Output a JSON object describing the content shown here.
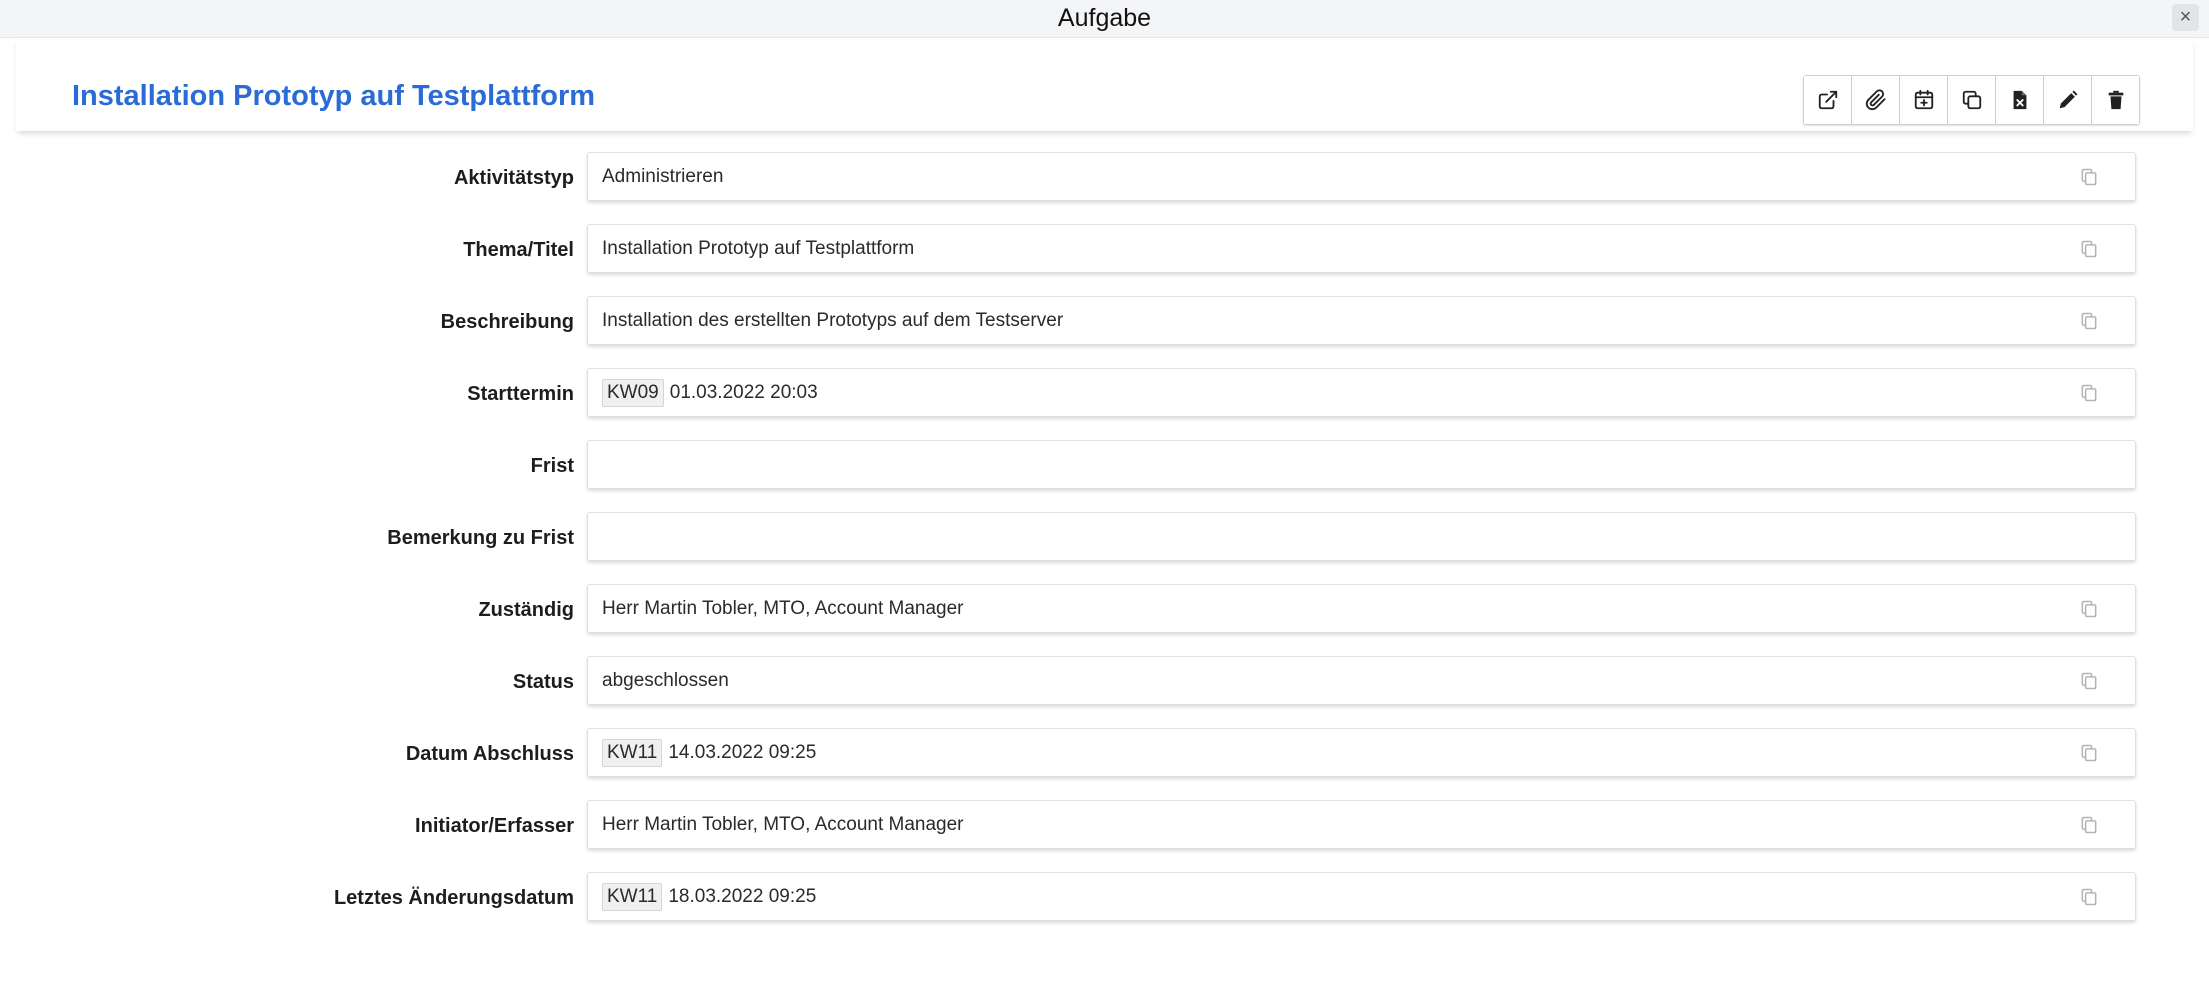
{
  "window": {
    "title": "Aufgabe",
    "close_symbol": "×"
  },
  "header": {
    "title": "Installation Prototyp auf Testplattform"
  },
  "toolbar": [
    {
      "name": "open-external-button",
      "icon": "external-link-icon"
    },
    {
      "name": "attachment-button",
      "icon": "paperclip-icon"
    },
    {
      "name": "add-appointment-button",
      "icon": "calendar-plus-icon"
    },
    {
      "name": "copy-button",
      "icon": "copy-icon"
    },
    {
      "name": "export-pdf-button",
      "icon": "file-pdf-icon"
    },
    {
      "name": "edit-button",
      "icon": "pencil-icon"
    },
    {
      "name": "delete-button",
      "icon": "trash-icon"
    }
  ],
  "fields": {
    "aktivitaetstyp": {
      "label": "Aktivitätstyp",
      "value": "Administrieren"
    },
    "thema": {
      "label": "Thema/Titel",
      "value": "Installation Prototyp auf Testplattform"
    },
    "beschreibung": {
      "label": "Beschreibung",
      "value": "Installation des erstellten Prototyps auf dem Testserver"
    },
    "starttermin": {
      "label": "Starttermin",
      "kw": "KW09",
      "value": "01.03.2022 20:03"
    },
    "frist": {
      "label": "Frist",
      "value": ""
    },
    "bemerkung": {
      "label": "Bemerkung zu Frist",
      "value": ""
    },
    "zustaendig": {
      "label": "Zuständig",
      "value": "Herr Martin Tobler, MTO, Account Manager"
    },
    "status": {
      "label": "Status",
      "value": "abgeschlossen"
    },
    "abschluss": {
      "label": "Datum Abschluss",
      "kw": "KW11",
      "value": "14.03.2022 09:25"
    },
    "initiator": {
      "label": "Initiator/Erfasser",
      "value": "Herr Martin Tobler, MTO, Account Manager"
    },
    "aenderung": {
      "label": "Letztes Änderungsdatum",
      "kw": "KW11",
      "value": "18.03.2022 09:25"
    }
  }
}
